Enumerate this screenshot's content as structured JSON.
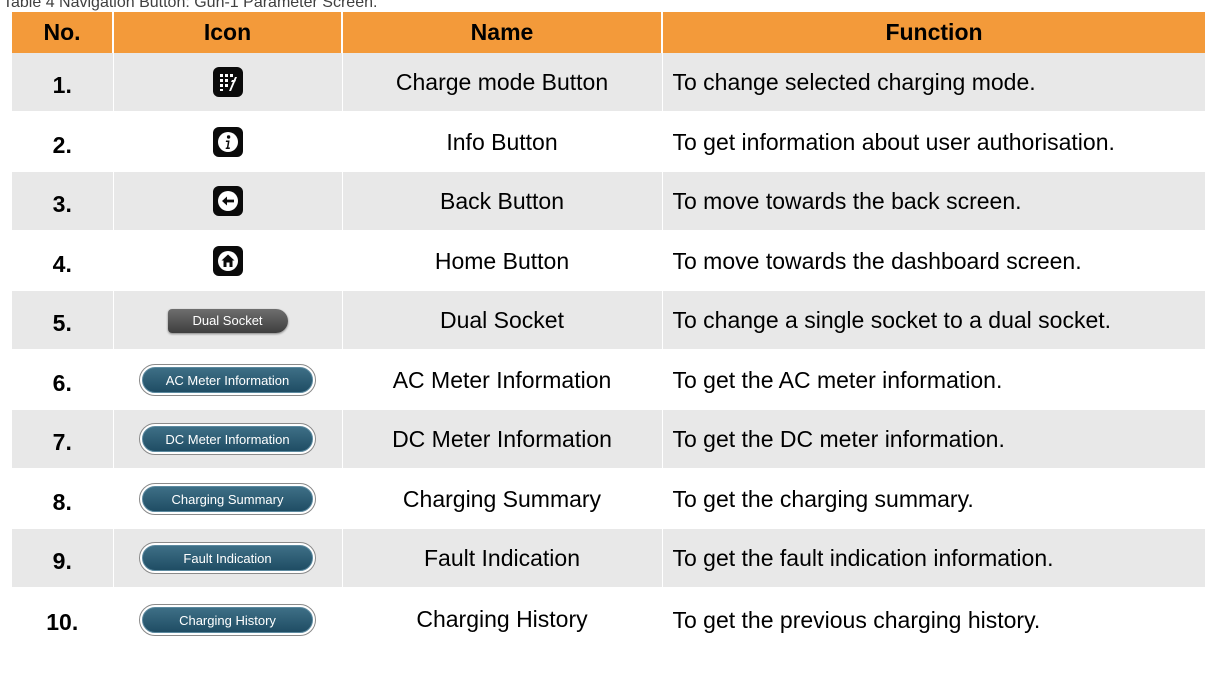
{
  "caption": "Table 4 Navigation Button: Gun-1 Parameter Screen.",
  "headers": {
    "no": "No.",
    "icon": "Icon",
    "name": "Name",
    "function": "Function"
  },
  "rows": [
    {
      "no": "1.",
      "icon": "charge-mode-icon",
      "name": "Charge mode Button",
      "function": "To change selected charging mode."
    },
    {
      "no": "2.",
      "icon": "info-icon",
      "name": "Info Button",
      "function": "To get information about user authorisation."
    },
    {
      "no": "3.",
      "icon": "back-arrow-icon",
      "name": "Back Button",
      "function": "To move towards the back screen."
    },
    {
      "no": "4.",
      "icon": "home-icon",
      "name": "Home Button",
      "function": "To move towards the dashboard screen."
    },
    {
      "no": "5.",
      "icon_label": "Dual Socket",
      "name": "Dual Socket",
      "function": "To change a single socket to a dual socket."
    },
    {
      "no": "6.",
      "icon_label": "AC Meter Information",
      "name": "AC Meter Information",
      "function": "To get the AC meter information."
    },
    {
      "no": "7.",
      "icon_label": "DC Meter Information",
      "name": "DC Meter Information",
      "function": "To get the DC meter information."
    },
    {
      "no": "8.",
      "icon_label": "Charging Summary",
      "name": "Charging Summary",
      "function": "To get the charging summary."
    },
    {
      "no": "9.",
      "icon_label": "Fault Indication",
      "name": "Fault Indication",
      "function": "To get the fault indication information."
    },
    {
      "no": "10.",
      "icon_label": "Charging History",
      "name": "Charging History",
      "function": "To get the previous charging history."
    }
  ],
  "colors": {
    "header_bg": "#f39a3a",
    "row_alt_bg": "#e8e8e8",
    "icon_bg": "#0b0b0b",
    "pill_teal": "#2b5c74",
    "pill_gray": "#555555"
  }
}
